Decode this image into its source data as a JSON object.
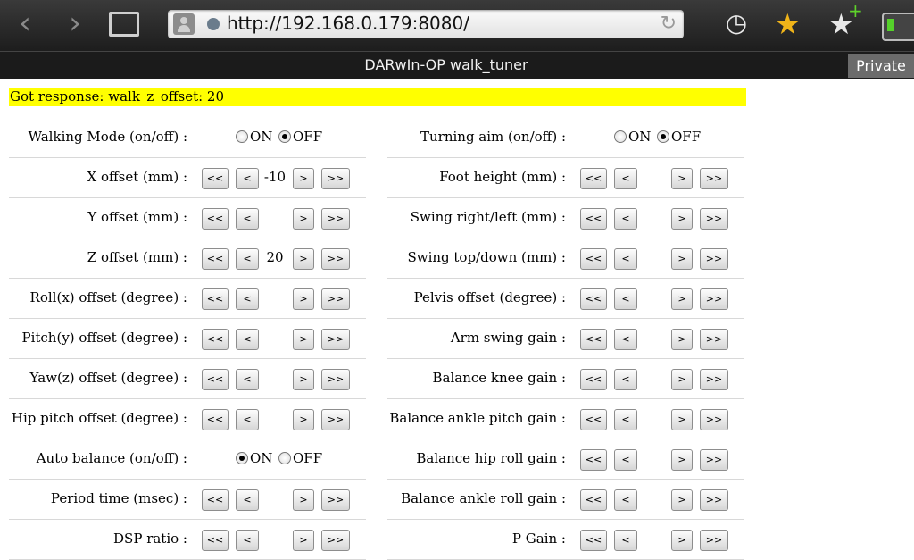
{
  "browser": {
    "back_icon": "back-arrow-icon",
    "forward_icon": "forward-arrow-icon",
    "url": "http://192.168.0.179:8080/",
    "title": "DARwIn-OP walk_tuner",
    "private_label": "Private"
  },
  "response": "Got response: walk_z_offset: 20",
  "buttons": {
    "ll": "<<",
    "l": "<",
    "r": ">",
    "rr": ">>"
  },
  "radio_labels": {
    "on": "ON",
    "off": "OFF"
  },
  "left": [
    {
      "label": "Walking Mode (on/off) :",
      "type": "toggle",
      "value": "OFF"
    },
    {
      "label": "X offset (mm) :",
      "value": "-10"
    },
    {
      "label": "Y offset (mm) :",
      "value": ""
    },
    {
      "label": "Z offset (mm) :",
      "value": "20"
    },
    {
      "label": "Roll(x) offset (degree) :",
      "value": ""
    },
    {
      "label": "Pitch(y) offset (degree) :",
      "value": ""
    },
    {
      "label": "Yaw(z) offset (degree) :",
      "value": ""
    },
    {
      "label": "Hip pitch offset (degree) :",
      "value": ""
    },
    {
      "label": "Auto balance (on/off) :",
      "type": "toggle",
      "value": "ON"
    },
    {
      "label": "Period time (msec) :",
      "value": ""
    },
    {
      "label": "DSP ratio :",
      "value": ""
    }
  ],
  "right": [
    {
      "label": "Turning aim (on/off) :",
      "type": "toggle",
      "value": "OFF"
    },
    {
      "label": "Foot height (mm) :",
      "value": ""
    },
    {
      "label": "Swing right/left (mm) :",
      "value": ""
    },
    {
      "label": "Swing top/down (mm) :",
      "value": ""
    },
    {
      "label": "Pelvis offset (degree) :",
      "value": ""
    },
    {
      "label": "Arm swing gain :",
      "value": ""
    },
    {
      "label": "Balance knee gain :",
      "value": ""
    },
    {
      "label": "Balance ankle pitch gain :",
      "value": ""
    },
    {
      "label": "Balance hip roll gain :",
      "value": ""
    },
    {
      "label": "Balance ankle roll gain :",
      "value": ""
    },
    {
      "label": "P Gain :",
      "value": ""
    }
  ]
}
